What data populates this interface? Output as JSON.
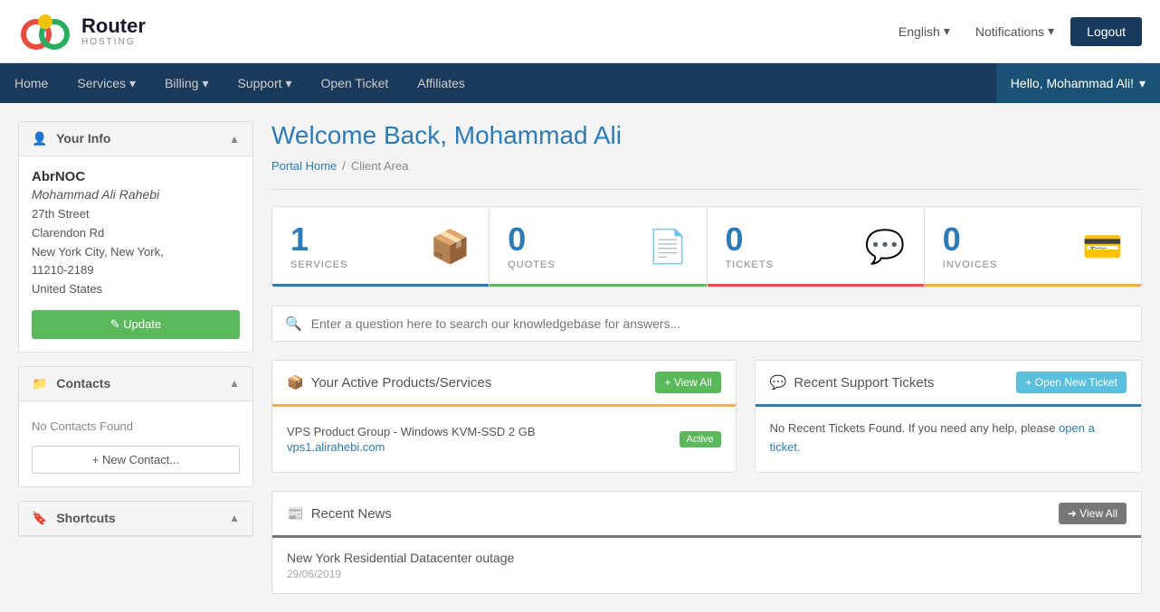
{
  "topbar": {
    "logo_text": "Router",
    "logo_sub": "HOSTING",
    "language_label": "English",
    "language_icon": "▾",
    "notifications_label": "Notifications",
    "notifications_icon": "▾",
    "logout_label": "Logout"
  },
  "nav": {
    "home": "Home",
    "services": "Services",
    "billing": "Billing",
    "support": "Support",
    "open_ticket": "Open Ticket",
    "affiliates": "Affiliates",
    "user_greeting": "Hello, Mohammad Ali!",
    "user_icon": "▾"
  },
  "sidebar": {
    "your_info_title": "Your Info",
    "company": "AbrNOC",
    "name": "Mohammad Ali Rahebi",
    "address1": "27th Street",
    "address2": "Clarendon Rd",
    "city_state": "New York City, New York,",
    "zip": "11210-2189",
    "country": "United States",
    "update_btn": "✎ Update",
    "contacts_title": "Contacts",
    "no_contacts": "No Contacts Found",
    "new_contact_btn": "+ New Contact...",
    "shortcuts_title": "Shortcuts"
  },
  "main": {
    "page_title": "Welcome Back, Mohammad Ali",
    "breadcrumb_home": "Portal Home",
    "breadcrumb_sep": "/",
    "breadcrumb_current": "Client Area",
    "stats": [
      {
        "number": "1",
        "label": "SERVICES",
        "color": "blue"
      },
      {
        "number": "0",
        "label": "QUOTES",
        "color": "green"
      },
      {
        "number": "0",
        "label": "TICKETS",
        "color": "red"
      },
      {
        "number": "0",
        "label": "INVOICES",
        "color": "orange"
      }
    ],
    "search_placeholder": "Enter a question here to search our knowledgebase for answers...",
    "products_title": "Your Active Products/Services",
    "products_view_all": "+ View All",
    "service_name": "VPS Product Group - Windows KVM-SSD 2 GB",
    "service_status": "Active",
    "service_link": "vps1.alirahebi.com",
    "tickets_title": "Recent Support Tickets",
    "tickets_open_btn": "+ Open New Ticket",
    "tickets_empty": "No Recent Tickets Found. If you need any help, please",
    "tickets_link_text": "open a ticket.",
    "news_title": "Recent News",
    "news_view_all": "➜ View All",
    "news_item_title": "New York Residential Datacenter outage",
    "news_item_date": "29/06/2019"
  }
}
